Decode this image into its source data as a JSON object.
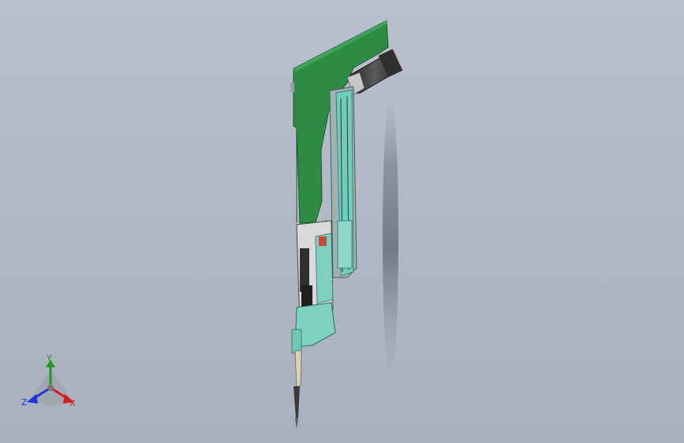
{
  "viewport": {
    "background_top": "#b9c0cc",
    "background_bottom": "#a9b0be"
  },
  "model": {
    "pcb_color": "#2e8b45",
    "carriage_color": "#7fd0c0",
    "motor_color": "#3c3c3c",
    "shadow_color": "#6f7480"
  },
  "triad": {
    "x_label": "X",
    "y_label": "Y",
    "z_label": "Z",
    "x_color": "#d21c1c",
    "y_color": "#1f9a1f",
    "z_color": "#1e34d8"
  }
}
